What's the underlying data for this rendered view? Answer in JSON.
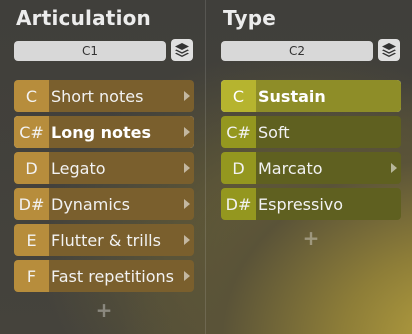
{
  "articulation": {
    "title": "Articulation",
    "selector": "C1",
    "items": [
      {
        "key": "C",
        "label": "Short notes",
        "submenu": true,
        "selected": false
      },
      {
        "key": "C#",
        "label": "Long notes",
        "submenu": true,
        "selected": true
      },
      {
        "key": "D",
        "label": "Legato",
        "submenu": true,
        "selected": false
      },
      {
        "key": "D#",
        "label": "Dynamics",
        "submenu": true,
        "selected": false
      },
      {
        "key": "E",
        "label": "Flutter & trills",
        "submenu": true,
        "selected": false
      },
      {
        "key": "F",
        "label": "Fast repetitions",
        "submenu": true,
        "selected": false
      }
    ],
    "add_label": "+"
  },
  "type": {
    "title": "Type",
    "selector": "C2",
    "items": [
      {
        "key": "C",
        "label": "Sustain",
        "submenu": false,
        "selected": true
      },
      {
        "key": "C#",
        "label": "Soft",
        "submenu": false,
        "selected": false
      },
      {
        "key": "D",
        "label": "Marcato",
        "submenu": true,
        "selected": false
      },
      {
        "key": "D#",
        "label": "Espressivo",
        "submenu": false,
        "selected": false
      }
    ],
    "add_label": "+"
  },
  "icons": {
    "layers": "layers-icon",
    "submenu": "chevron-right-icon",
    "add": "plus-icon"
  }
}
